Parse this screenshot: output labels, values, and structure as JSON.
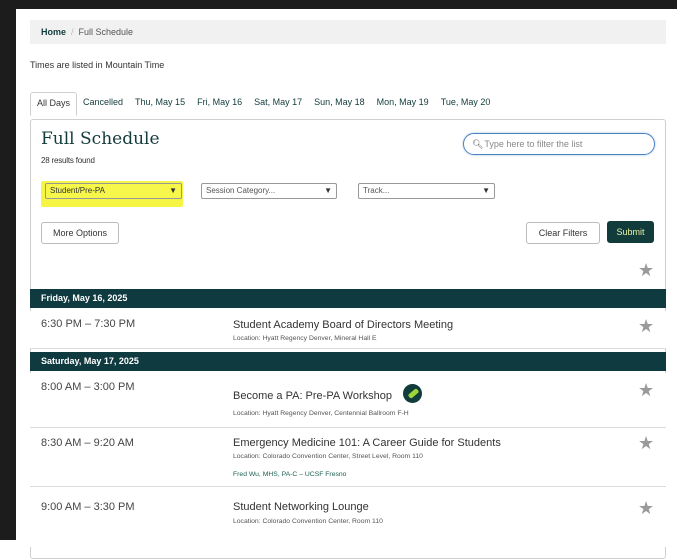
{
  "breadcrumb": {
    "home": "Home",
    "separator": "/",
    "current": "Full Schedule"
  },
  "timezone_note": "Times are listed in Mountain Time",
  "tabs": [
    "All Days",
    "Cancelled",
    "Thu, May 15",
    "Fri, May 16",
    "Sat, May 17",
    "Sun, May 18",
    "Mon, May 19",
    "Tue, May 20"
  ],
  "header": {
    "title": "Full Schedule",
    "results": "28 results found"
  },
  "search": {
    "placeholder": "Type here to filter the list"
  },
  "filters": {
    "audience": "Student/Pre-PA",
    "session_category": "Session Category...",
    "track": "Track..."
  },
  "buttons": {
    "more_options": "More Options",
    "clear_filters": "Clear Filters",
    "submit": "Submit"
  },
  "days": [
    {
      "label": "Friday, May 16, 2025",
      "sessions": [
        {
          "time": "6:30 PM – 7:30 PM",
          "title": "Student Academy Board of Directors Meeting",
          "location": "Location: Hyatt Regency Denver, Mineral Hall E"
        }
      ]
    },
    {
      "label": "Saturday, May 17, 2025",
      "sessions": [
        {
          "time": "8:00 AM – 3:00 PM",
          "title": "Become a PA: Pre-PA Workshop",
          "location": "Location: Hyatt Regency Denver, Centennial Ballroom F-H"
        },
        {
          "time": "8:30 AM – 9:20 AM",
          "title": "Emergency Medicine 101: A Career Guide for Students",
          "location": "Location: Colorado Convention Center, Street Level, Room 110",
          "speaker": "Fred Wu, MHS, PA-C – UCSF Fresno"
        },
        {
          "time": "9:00 AM – 3:30 PM",
          "title": "Student Networking Lounge",
          "location": "Location: Colorado Convention Center, Room 110"
        }
      ]
    }
  ],
  "colors": {
    "brand": "#123b3b",
    "day_header": "#0f3a40",
    "submit_text": "#e8f5a6",
    "highlight": "#f5f323"
  },
  "icons": {
    "search": "search-icon",
    "star": "star-icon",
    "dropdown": "chevron-down-icon",
    "badge": "aapa-badge-icon"
  }
}
